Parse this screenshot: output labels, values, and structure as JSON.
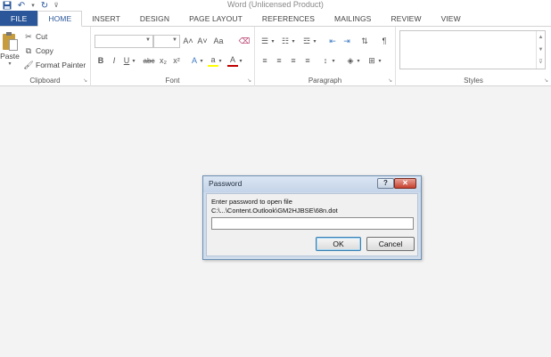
{
  "window": {
    "title": "Word (Unlicensed Product)"
  },
  "qat": {
    "save_icon": "save-icon",
    "undo_icon": "undo-icon",
    "redo_icon": "redo-icon",
    "customize_icon": "dropdown-icon"
  },
  "tabs": [
    {
      "label": "FILE"
    },
    {
      "label": "HOME"
    },
    {
      "label": "INSERT"
    },
    {
      "label": "DESIGN"
    },
    {
      "label": "PAGE LAYOUT"
    },
    {
      "label": "REFERENCES"
    },
    {
      "label": "MAILINGS"
    },
    {
      "label": "REVIEW"
    },
    {
      "label": "VIEW"
    }
  ],
  "ribbon": {
    "clipboard": {
      "label": "Clipboard",
      "paste": "Paste",
      "cut": "Cut",
      "copy": "Copy",
      "format_painter": "Format Painter"
    },
    "font": {
      "label": "Font",
      "font_name": "",
      "font_size": "",
      "grow": "A˄",
      "shrink": "A˅",
      "change_case": "Aa",
      "bold": "B",
      "italic": "I",
      "underline": "U",
      "strikethrough": "abc",
      "subscript": "x₂",
      "superscript": "x²",
      "text_effects": "A",
      "highlight": "a",
      "font_color": "A"
    },
    "paragraph": {
      "label": "Paragraph",
      "pilcrow": "¶"
    },
    "styles": {
      "label": "Styles"
    }
  },
  "dialog": {
    "title": "Password",
    "help": "?",
    "close": "✕",
    "prompt": "Enter password to open file",
    "path": "C:\\...\\Content.Outlook\\GM2HJBSE\\68n.dot",
    "password_value": "",
    "ok": "OK",
    "cancel": "Cancel"
  },
  "colors": {
    "accent": "#2b579a",
    "close_red": "#c6402e",
    "dialog_frame": "#cfdcec"
  }
}
